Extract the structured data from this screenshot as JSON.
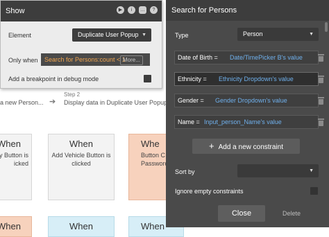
{
  "canvas": {
    "step_left_text": "a new Person...",
    "step2_number": "Step 2",
    "step2_text": "Display data in Duplicate User Popup",
    "cards": [
      {
        "when": "When",
        "text": "ty Button is\nicked"
      },
      {
        "when": "When",
        "text": "Add Vehicle Button is\nclicked"
      },
      {
        "when": "Whe",
        "text": "Button C\nPassword i"
      },
      {
        "when": "When",
        "text": ""
      },
      {
        "when": "When",
        "text": ""
      },
      {
        "when": "When",
        "text": ""
      }
    ]
  },
  "show_panel": {
    "title": "Show",
    "element_label": "Element",
    "element_value": "Duplicate User Popup",
    "only_when_label": "Only when",
    "only_when_value": "Search for Persons:count < 1",
    "more_label": "More...",
    "breakpoint_label": "Add a breakpoint in debug mode",
    "icons": [
      "play-icon",
      "info-icon",
      "comment-icon",
      "help-icon",
      "close-icon"
    ]
  },
  "search_panel": {
    "title": "Search for Persons",
    "type_label": "Type",
    "type_value": "Person",
    "constraints": [
      {
        "field": "Date of Birth =",
        "value": "Date/TimePicker B's value"
      },
      {
        "field": "Ethnicity =",
        "value": "Ethnicity Dropdown's value"
      },
      {
        "field": "Gender =",
        "value": "Gender Dropdown's value"
      },
      {
        "field": "Name =",
        "value": "Input_person_Name's value"
      }
    ],
    "add_constraint_label": "Add a new constraint",
    "sort_by_label": "Sort by",
    "sort_by_value": "",
    "ignore_empty_label": "Ignore empty constraints",
    "close_label": "Close",
    "delete_label": "Delete"
  },
  "colors": {
    "panel_dark": "#4a4a4a",
    "header_dark": "#3d3d3d",
    "dynamic_value_blue": "#6fb0ec",
    "condition_orange": "#f0a550",
    "card_orange": "#f7d2bd",
    "card_blue": "#d7eef7"
  }
}
